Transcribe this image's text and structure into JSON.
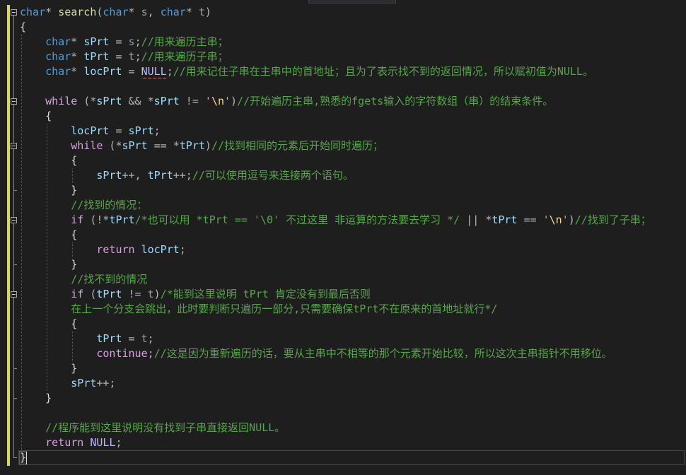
{
  "editor": {
    "current_line": 31,
    "lines": [
      {
        "fold": true,
        "tokens": [
          {
            "text": "char",
            "color": "#569cd6"
          },
          {
            "text": "* ",
            "color": "#b4b4b4"
          },
          {
            "text": "search",
            "color": "#dcdcaa"
          },
          {
            "text": "(",
            "color": "#b4b4b4"
          },
          {
            "text": "char",
            "color": "#569cd6"
          },
          {
            "text": "* ",
            "color": "#b4b4b4"
          },
          {
            "text": "s",
            "color": "#9a9a9a"
          },
          {
            "text": ", ",
            "color": "#b4b4b4"
          },
          {
            "text": "char",
            "color": "#569cd6"
          },
          {
            "text": "* ",
            "color": "#b4b4b4"
          },
          {
            "text": "t",
            "color": "#9a9a9a"
          },
          {
            "text": ")",
            "color": "#b4b4b4"
          }
        ]
      },
      {
        "tokens": [
          {
            "text": "{",
            "color": "#dcdcdc"
          }
        ]
      },
      {
        "tokens": [
          {
            "text": "    char",
            "color": "#569cd6"
          },
          {
            "text": "* ",
            "color": "#b4b4b4"
          },
          {
            "text": "sPrt",
            "color": "#9cdcfe"
          },
          {
            "text": " = ",
            "color": "#b4b4b4"
          },
          {
            "text": "s",
            "color": "#9a9a9a"
          },
          {
            "text": ";",
            "color": "#b4b4b4"
          },
          {
            "text": "//用来遍历主串；",
            "color": "#57a64a"
          }
        ]
      },
      {
        "tokens": [
          {
            "text": "    char",
            "color": "#569cd6"
          },
          {
            "text": "* ",
            "color": "#b4b4b4"
          },
          {
            "text": "tPrt",
            "color": "#9cdcfe"
          },
          {
            "text": " = ",
            "color": "#b4b4b4"
          },
          {
            "text": "t",
            "color": "#9a9a9a"
          },
          {
            "text": ";",
            "color": "#b4b4b4"
          },
          {
            "text": "//用来遍历子串；",
            "color": "#57a64a"
          }
        ]
      },
      {
        "tokens": [
          {
            "text": "    char",
            "color": "#569cd6"
          },
          {
            "text": "* ",
            "color": "#b4b4b4"
          },
          {
            "text": "locPrt",
            "color": "#9cdcfe"
          },
          {
            "text": " = ",
            "color": "#b4b4b4"
          },
          {
            "text": "NULL",
            "color": "#beb7ff",
            "squiggle": true
          },
          {
            "text": ";",
            "color": "#b4b4b4"
          },
          {
            "text": "//用来记住子串在主串中的首地址；且为了表示找不到的返回情况，所以赋初值为NULL。",
            "color": "#57a64a"
          }
        ]
      },
      {
        "tokens": []
      },
      {
        "fold": true,
        "tokens": [
          {
            "text": "    while",
            "color": "#d8a0df"
          },
          {
            "text": " (*",
            "color": "#b4b4b4"
          },
          {
            "text": "sPrt",
            "color": "#9cdcfe"
          },
          {
            "text": " && *",
            "color": "#b4b4b4"
          },
          {
            "text": "sPrt",
            "color": "#9cdcfe"
          },
          {
            "text": " != ",
            "color": "#b4b4b4"
          },
          {
            "text": "'",
            "color": "#d69d85"
          },
          {
            "text": "\\n",
            "color": "#ffd68f"
          },
          {
            "text": "'",
            "color": "#d69d85"
          },
          {
            "text": ")",
            "color": "#b4b4b4"
          },
          {
            "text": "//开始遍历主串,熟悉的fgets输入的字符数组（串）的结束条件。",
            "color": "#57a64a"
          }
        ]
      },
      {
        "tokens": [
          {
            "text": "    {",
            "color": "#dcdcdc"
          }
        ]
      },
      {
        "tokens": [
          {
            "text": "        locPrt",
            "color": "#9cdcfe"
          },
          {
            "text": " = ",
            "color": "#b4b4b4"
          },
          {
            "text": "sPrt",
            "color": "#9cdcfe"
          },
          {
            "text": ";",
            "color": "#b4b4b4"
          }
        ]
      },
      {
        "fold": true,
        "tokens": [
          {
            "text": "        while",
            "color": "#d8a0df"
          },
          {
            "text": " (*",
            "color": "#b4b4b4"
          },
          {
            "text": "sPrt",
            "color": "#9cdcfe"
          },
          {
            "text": " == *",
            "color": "#b4b4b4"
          },
          {
            "text": "tPrt",
            "color": "#9cdcfe"
          },
          {
            "text": ")",
            "color": "#b4b4b4"
          },
          {
            "text": "//找到相同的元素后开始同时遍历；",
            "color": "#57a64a"
          }
        ]
      },
      {
        "tokens": [
          {
            "text": "        {",
            "color": "#dcdcdc"
          }
        ]
      },
      {
        "tokens": [
          {
            "text": "            sPrt",
            "color": "#9cdcfe"
          },
          {
            "text": "++, ",
            "color": "#b4b4b4"
          },
          {
            "text": "tPrt",
            "color": "#9cdcfe"
          },
          {
            "text": "++;",
            "color": "#b4b4b4"
          },
          {
            "text": "//可以使用逗号来连接两个语句。",
            "color": "#57a64a"
          }
        ]
      },
      {
        "tokens": [
          {
            "text": "        }",
            "color": "#dcdcdc"
          }
        ]
      },
      {
        "tokens": [
          {
            "text": "        //找到的情况：",
            "color": "#57a64a"
          }
        ]
      },
      {
        "fold": true,
        "tokens": [
          {
            "text": "        if",
            "color": "#d8a0df"
          },
          {
            "text": " (!*",
            "color": "#b4b4b4"
          },
          {
            "text": "tPrt",
            "color": "#9cdcfe"
          },
          {
            "text": "/*也可以用 *tPrt == '\\0' 不过这里 非运算的方法要去学习 */",
            "color": "#57a64a"
          },
          {
            "text": " || *",
            "color": "#b4b4b4"
          },
          {
            "text": "tPrt",
            "color": "#9cdcfe"
          },
          {
            "text": " == ",
            "color": "#b4b4b4"
          },
          {
            "text": "'",
            "color": "#d69d85"
          },
          {
            "text": "\\n",
            "color": "#ffd68f"
          },
          {
            "text": "'",
            "color": "#d69d85"
          },
          {
            "text": ")",
            "color": "#b4b4b4"
          },
          {
            "text": "//找到了子串；",
            "color": "#57a64a"
          }
        ]
      },
      {
        "tokens": [
          {
            "text": "        {",
            "color": "#dcdcdc"
          }
        ]
      },
      {
        "tokens": [
          {
            "text": "            return ",
            "color": "#d8a0df"
          },
          {
            "text": "locPrt",
            "color": "#9cdcfe"
          },
          {
            "text": ";",
            "color": "#b4b4b4"
          }
        ]
      },
      {
        "tokens": [
          {
            "text": "        }",
            "color": "#dcdcdc"
          }
        ]
      },
      {
        "tokens": [
          {
            "text": "        //找不到的情况",
            "color": "#57a64a"
          }
        ]
      },
      {
        "fold": true,
        "tokens": [
          {
            "text": "        if",
            "color": "#d8a0df"
          },
          {
            "text": " (",
            "color": "#b4b4b4"
          },
          {
            "text": "tPrt",
            "color": "#9cdcfe"
          },
          {
            "text": " != ",
            "color": "#b4b4b4"
          },
          {
            "text": "t",
            "color": "#9a9a9a"
          },
          {
            "text": ")",
            "color": "#b4b4b4"
          },
          {
            "text": "/*能到这里说明 tPrt 肯定没有到最后否则",
            "color": "#57a64a"
          }
        ]
      },
      {
        "tokens": [
          {
            "text": "        在上一个分支会跳出，此时要判断只遍历一部分,只需要确保tPrt不在原来的首地址就行*/",
            "color": "#57a64a"
          }
        ]
      },
      {
        "tokens": [
          {
            "text": "        {",
            "color": "#dcdcdc"
          }
        ]
      },
      {
        "tokens": [
          {
            "text": "            tPrt",
            "color": "#9cdcfe"
          },
          {
            "text": " = ",
            "color": "#b4b4b4"
          },
          {
            "text": "t",
            "color": "#9a9a9a"
          },
          {
            "text": ";",
            "color": "#b4b4b4"
          }
        ]
      },
      {
        "tokens": [
          {
            "text": "            continue",
            "color": "#d8a0df"
          },
          {
            "text": ";",
            "color": "#b4b4b4"
          },
          {
            "text": "//这是因为重新遍历的话，要从主串中不相等的那个元素开始比较，所以这次主串指针不用移位。",
            "color": "#57a64a"
          }
        ]
      },
      {
        "tokens": [
          {
            "text": "        }",
            "color": "#dcdcdc"
          }
        ]
      },
      {
        "tokens": [
          {
            "text": "        sPrt",
            "color": "#9cdcfe"
          },
          {
            "text": "++;",
            "color": "#b4b4b4"
          }
        ]
      },
      {
        "tokens": [
          {
            "text": "    }",
            "color": "#dcdcdc"
          }
        ]
      },
      {
        "tokens": []
      },
      {
        "tokens": [
          {
            "text": "    //程序能到这里说明没有找到子串直接返回NULL。",
            "color": "#57a64a"
          }
        ]
      },
      {
        "tokens": [
          {
            "text": "    return ",
            "color": "#d8a0df"
          },
          {
            "text": "NULL",
            "color": "#beb7ff"
          },
          {
            "text": ";",
            "color": "#b4b4b4"
          }
        ]
      },
      {
        "tokens": [
          {
            "text": "}",
            "color": "#dcdcdc"
          }
        ]
      }
    ]
  }
}
